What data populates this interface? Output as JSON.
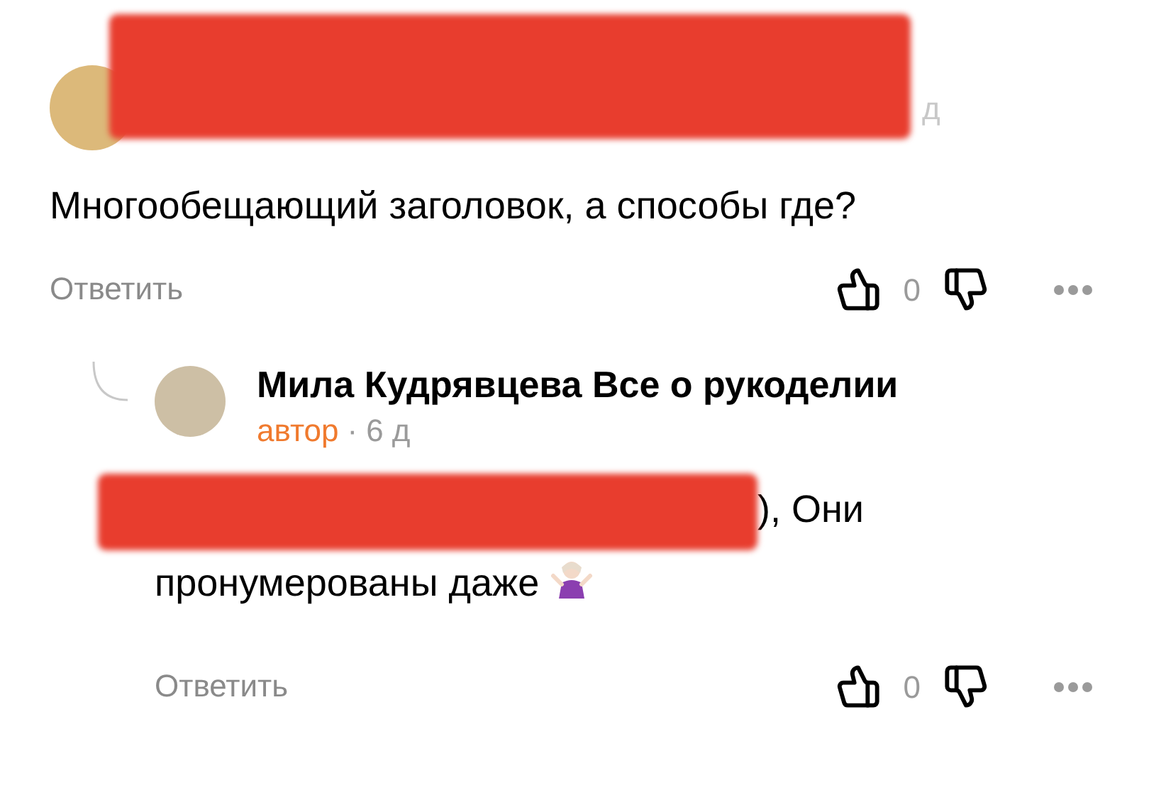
{
  "comments": [
    {
      "kind": "comment",
      "author_redacted": true,
      "time": "д",
      "text": "Многообещающий заголовок, а способы где?",
      "reply_label": "Ответить",
      "likes": "0"
    },
    {
      "kind": "reply",
      "author": "Мила Кудрявцева Все о рукоделии",
      "badge": "автор",
      "separator": "·",
      "time": "6 д",
      "text_redacted": true,
      "text": "), Они пронумерованы даже",
      "reply_label": "Ответить",
      "likes": "0"
    }
  ]
}
